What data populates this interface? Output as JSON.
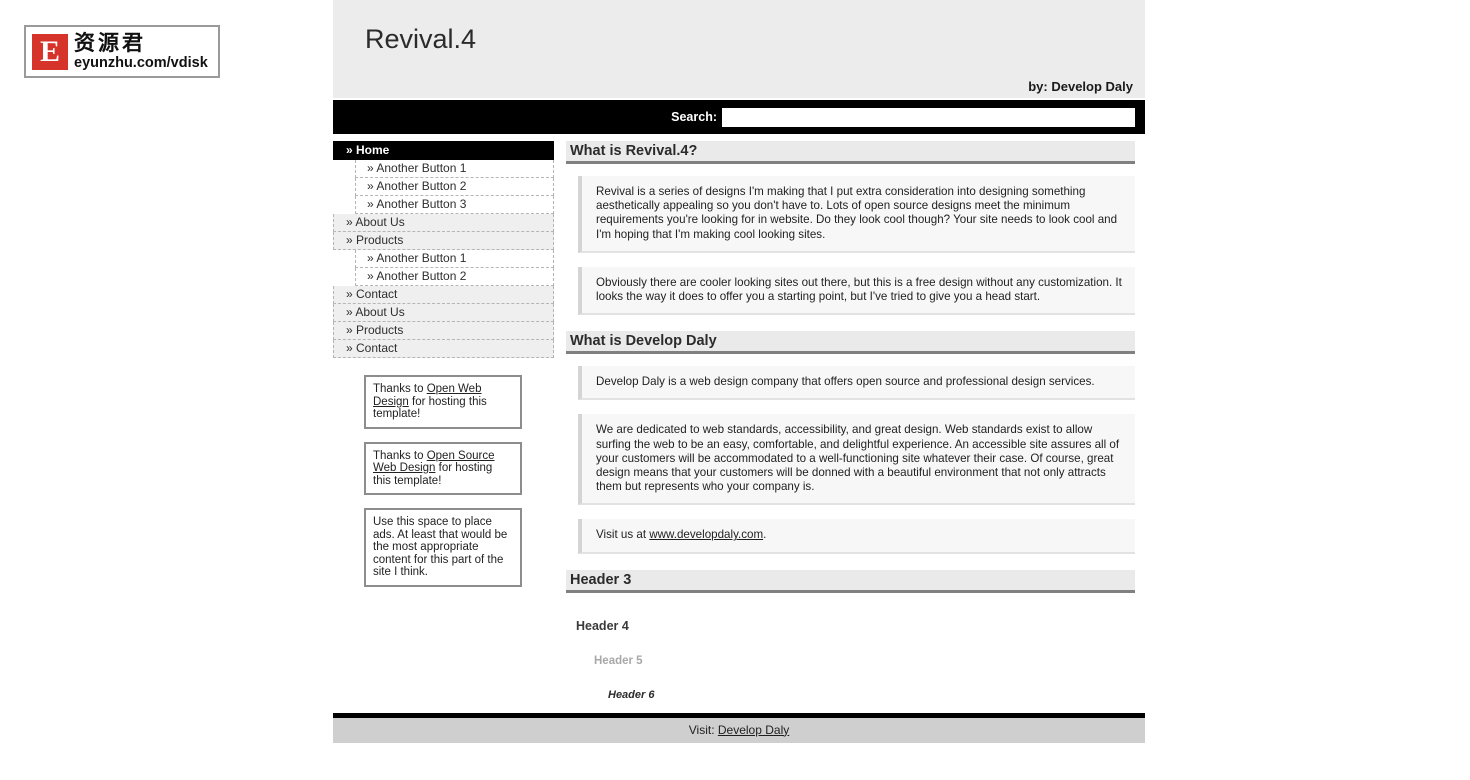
{
  "watermark": {
    "badge_letter": "E",
    "chinese_text": "资源君",
    "url_text": "eyunzhu.com/vdisk"
  },
  "header": {
    "site_title": "Revival.4",
    "author_credit": "by: Develop Daly"
  },
  "search": {
    "label": "Search:",
    "value": "",
    "placeholder": ""
  },
  "nav": {
    "items": [
      {
        "label": "» Home",
        "level": 1,
        "active": true
      },
      {
        "label": "» Another Button 1",
        "level": 2,
        "active": false
      },
      {
        "label": "» Another Button 2",
        "level": 2,
        "active": false
      },
      {
        "label": "» Another Button 3",
        "level": 2,
        "active": false
      },
      {
        "label": "» About Us",
        "level": 1,
        "active": false
      },
      {
        "label": "» Products",
        "level": 1,
        "active": false
      },
      {
        "label": "» Another Button 1",
        "level": 2,
        "active": false
      },
      {
        "label": "» Another Button 2",
        "level": 2,
        "active": false
      },
      {
        "label": "» Contact",
        "level": 1,
        "active": false
      },
      {
        "label": "» About Us",
        "level": 1,
        "active": false
      },
      {
        "label": "» Products",
        "level": 1,
        "active": false
      },
      {
        "label": "» Contact",
        "level": 1,
        "active": false
      }
    ]
  },
  "ads": {
    "box1": {
      "prefix": "Thanks to ",
      "link": "Open Web Design",
      "suffix": " for hosting this template!"
    },
    "box2": {
      "prefix": "Thanks to ",
      "link": "Open Source Web Design",
      "suffix": " for hosting this template!"
    },
    "box3": {
      "text": "Use this space to place ads. At least that would be the most appropriate content for this part of the site I think."
    }
  },
  "content": {
    "section1": {
      "heading": "What is Revival.4?",
      "para1": "Revival is a series of designs I'm making that I put extra consideration into designing something aesthetically appealing so you don't have to. Lots of open source designs meet the minimum requirements you're looking for in website. Do they look cool though? Your site needs to look cool and I'm hoping that I'm making cool looking sites.",
      "para2": "Obviously there are cooler looking sites out there, but this is a free design without any customization. It looks the way it does to offer you a starting point, but I've tried to give you a head start."
    },
    "section2": {
      "heading": "What is Develop Daly",
      "para1": "Develop Daly is a web design company that offers open source and professional design services.",
      "para2": "We are dedicated to web standards, accessibility, and great design. Web standards exist to allow surfing the web to be an easy, comfortable, and delightful experience. An accessible site assures all of your customers will be accommodated to a well-functioning site whatever their case. Of course, great design means that your customers will be donned with a beautiful environment that not only attracts them but represents who your company is.",
      "para3_prefix": "Visit us at ",
      "para3_link": "www.developdaly.com",
      "para3_suffix": "."
    },
    "section3": {
      "heading": "Header 3",
      "header4": "Header 4",
      "header5": "Header 5",
      "header6": "Header 6"
    }
  },
  "footer": {
    "prefix": "Visit: ",
    "link": "Develop Daly"
  },
  "colors": {
    "accent_red": "#d6342a",
    "bar_black": "#000000",
    "panel_gray": "#ececec",
    "footer_gray": "#cfcfcf"
  }
}
